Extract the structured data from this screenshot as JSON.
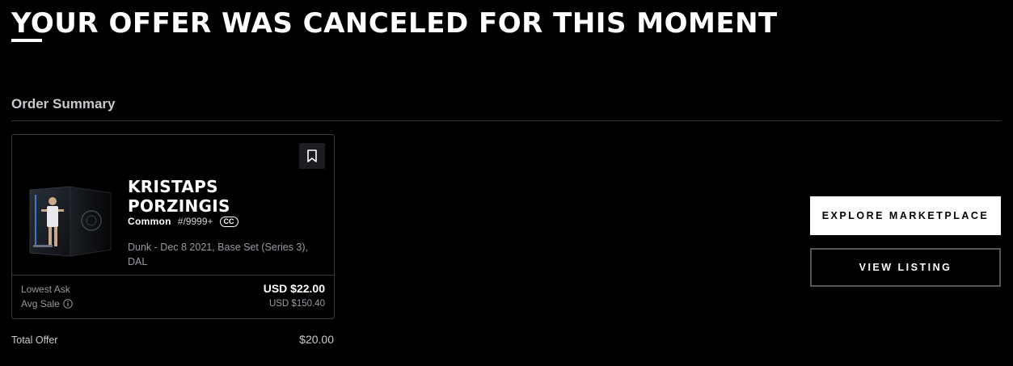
{
  "header": {
    "title": "YOUR OFFER WAS CANCELED FOR THIS MOMENT"
  },
  "order_summary": {
    "section_title": "Order Summary",
    "moment": {
      "player_name_line1": "KRISTAPS",
      "player_name_line2": "PORZINGIS",
      "tier": "Common",
      "serial": "#/9999+",
      "badge": "CC",
      "description": "Dunk - Dec 8 2021, Base Set (Series 3), DAL",
      "bookmark_icon": "bookmark-icon",
      "lowest_ask_label": "Lowest Ask",
      "lowest_ask_value": "USD $22.00",
      "avg_sale_label": "Avg Sale",
      "avg_sale_value": "USD $150.40",
      "info_icon": "info-icon"
    },
    "total_offer_label": "Total Offer",
    "total_offer_value": "$20.00"
  },
  "actions": {
    "explore_label": "EXPLORE MARKETPLACE",
    "view_listing_label": "VIEW LISTING"
  },
  "colors": {
    "background": "#000000",
    "text_primary": "#ffffff",
    "text_muted": "#9a9aa3",
    "border": "#3b3b40",
    "button_primary_bg": "#ffffff"
  }
}
